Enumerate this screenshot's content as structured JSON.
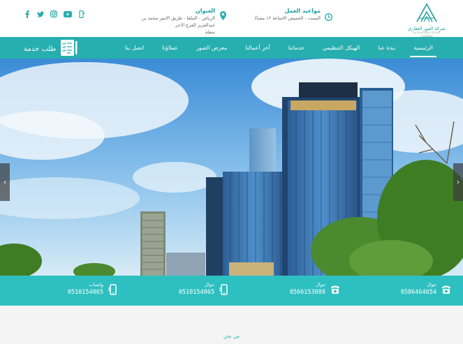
{
  "topbar": {
    "social": [
      "facebook-icon",
      "twitter-icon",
      "instagram-icon",
      "youtube-icon",
      "whatsapp-icon"
    ],
    "address": {
      "title": "العنوان",
      "line1": "الرياض - الملقا - طريق الامير محمد بن عبدالعزيز الفرع الاخر",
      "line2": "سفلة"
    },
    "hours": {
      "title": "مواعيد العمل",
      "line1": "السبت - الخميس الاساعة ١٢ مساءً"
    },
    "logo": {
      "name": "شركة الفوز العقاري",
      "sub": "AL FOUZ REAL ESTATE COMPANY"
    }
  },
  "nav": {
    "service_label": "طلب خدمة",
    "items": [
      "الرئيسية",
      "نبذة عنا",
      "الهيكل التنظيمي",
      "خدماتنا",
      "آخر أعمالنا",
      "معرض الصور",
      "عملاؤنا",
      "اتصل بنا"
    ],
    "active_index": 0
  },
  "contacts": [
    {
      "label": "جوال",
      "number": "0586464654",
      "icon": "phone-icon"
    },
    {
      "label": "جوال",
      "number": "0566153088",
      "icon": "phone-icon"
    },
    {
      "label": "جوال",
      "number": "0510154065",
      "icon": "mobile-icon"
    },
    {
      "label": "واتساب",
      "number": "0510154065",
      "icon": "mobile-icon"
    }
  ],
  "below": {
    "about_label": "من نحن"
  },
  "colors": {
    "brand": "#27aeae",
    "strip": "#2ec0c0"
  }
}
